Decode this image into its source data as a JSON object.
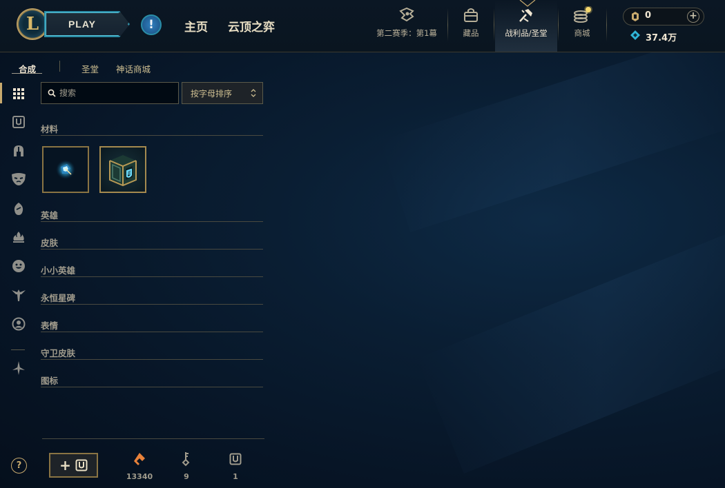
{
  "topbar": {
    "play_label": "PLAY",
    "nav": {
      "home": "主页",
      "tft": "云顶之弈"
    },
    "icon_nav": [
      {
        "id": "season",
        "label": "第二赛季：第1幕",
        "icon": "season-pass-icon"
      },
      {
        "id": "collection",
        "label": "藏品",
        "icon": "collection-bag-icon"
      },
      {
        "id": "loot",
        "label": "战利品/圣堂",
        "icon": "loot-crafting-icon",
        "active": true
      },
      {
        "id": "store",
        "label": "商城",
        "icon": "store-coins-icon"
      }
    ],
    "currency": {
      "rp": "0",
      "blue_essence": "37.4万"
    }
  },
  "subtabs": [
    {
      "label": "合成",
      "active": true
    },
    {
      "label": "圣堂",
      "active": false
    },
    {
      "label": "神话商城",
      "active": false
    }
  ],
  "rail_icons": [
    "all-items-grid-icon",
    "chest-icon",
    "champion-helmet-icon",
    "skin-mask-icon",
    "little-legend-icon",
    "eternals-flame-icon",
    "emote-face-icon",
    "ward-skin-icon",
    "profile-icon-icon",
    "misc-loot-icon"
  ],
  "search": {
    "placeholder": "搜索",
    "value": ""
  },
  "sort": {
    "selected": "按字母排序"
  },
  "categories": [
    {
      "title": "材料",
      "items": [
        "key-fragment",
        "hextech-chest"
      ]
    },
    {
      "title": "英雄"
    },
    {
      "title": "皮肤"
    },
    {
      "title": "小小英雄"
    },
    {
      "title": "永恒星碑"
    },
    {
      "title": "表情"
    },
    {
      "title": "守卫皮肤"
    },
    {
      "title": "图标"
    }
  ],
  "bottom": {
    "add_chest_label": "+",
    "resources": [
      {
        "icon": "orange-essence-icon",
        "count": "13340"
      },
      {
        "icon": "key-icon",
        "count": "9"
      },
      {
        "icon": "chest-icon",
        "count": "1"
      }
    ]
  },
  "colors": {
    "gold": "#c8aa6e",
    "cyan": "#2a8ea8",
    "text_light": "#f0e6d2",
    "text_muted": "#a09b8c",
    "orange_essence": "#e8823a",
    "blue_essence": "#2fb5d8"
  }
}
